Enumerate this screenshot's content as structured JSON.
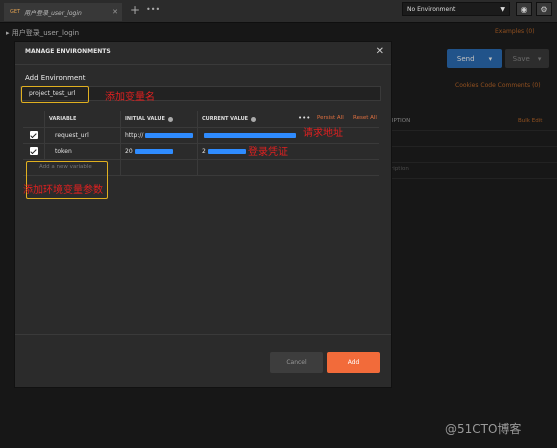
{
  "topbar": {
    "tab": {
      "method": "GET",
      "name": "用户登录_user_login",
      "close_icon": "close-icon"
    },
    "new_tab_icon": "plus-icon",
    "more_icon": "ellipsis-icon",
    "environment_select": "No Environment",
    "eye_icon": "eye-icon",
    "settings_icon": "gear-icon"
  },
  "request": {
    "name": "用户登录_user_login",
    "examples_label": "Examples (0)",
    "send_label": "Send",
    "save_label": "Save",
    "links": "Cookies  Code  Comments (0)",
    "description_header": "RIPTION",
    "bulk_edit": "Bulk Edit",
    "description_placeholder": "cription"
  },
  "modal": {
    "title": "MANAGE ENVIRONMENTS",
    "subtitle": "Add Environment",
    "env_name": "project_test_url",
    "columns": {
      "variable": "VARIABLE",
      "initial": "INITIAL VALUE",
      "current": "CURRENT VALUE",
      "persist_all": "Persist All",
      "reset_all": "Reset All"
    },
    "rows": [
      {
        "variable": "request_url",
        "initial": "http://",
        "current": "",
        "checked": true
      },
      {
        "variable": "token",
        "initial": "20",
        "current": "2",
        "checked": true
      }
    ],
    "add_placeholder": "Add a new variable",
    "cancel_label": "Cancel",
    "add_label": "Add"
  },
  "annotations": {
    "name_note": "添加变量名",
    "url_note": "请求地址",
    "token_note": "登录凭证",
    "params_note": "添加环境变量参数"
  },
  "watermark": "@51CTO博客",
  "colors": {
    "accent": "#f26b3a",
    "send": "#2d6fb8",
    "highlight_box": "#e0b020",
    "annotation": "#e02020"
  }
}
